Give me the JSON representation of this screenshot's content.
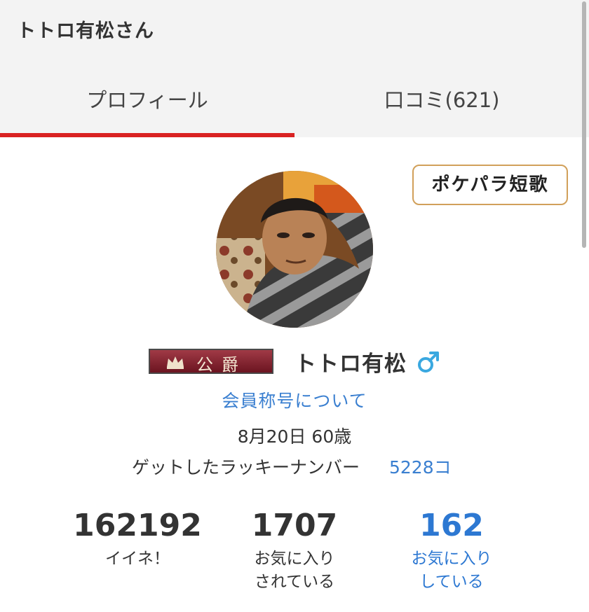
{
  "header": {
    "title": "トトロ有松さん",
    "tabs": [
      {
        "label": "プロフィール",
        "active": true
      },
      {
        "label": "口コミ(621)",
        "active": false
      }
    ],
    "active_color": "#d92222"
  },
  "profile": {
    "tanka_button_label": "ポケパラ短歌",
    "rank_badge": "公爵",
    "username": "トトロ有松",
    "gender_icon": "male-symbol-icon",
    "member_title_link": "会員称号について",
    "birth_age": "8月20日 60歳",
    "lucky_number_label": "ゲットしたラッキーナンバー",
    "lucky_number_value": "5228コ",
    "link_color": "#3a7fd0"
  },
  "stats": [
    {
      "value": "162192",
      "label_line1": "イイネ！",
      "label_line2": ""
    },
    {
      "value": "1707",
      "label_line1": "お気に入り",
      "label_line2": "されている"
    },
    {
      "value": "162",
      "label_line1": "お気に入り",
      "label_line2": "している"
    }
  ]
}
